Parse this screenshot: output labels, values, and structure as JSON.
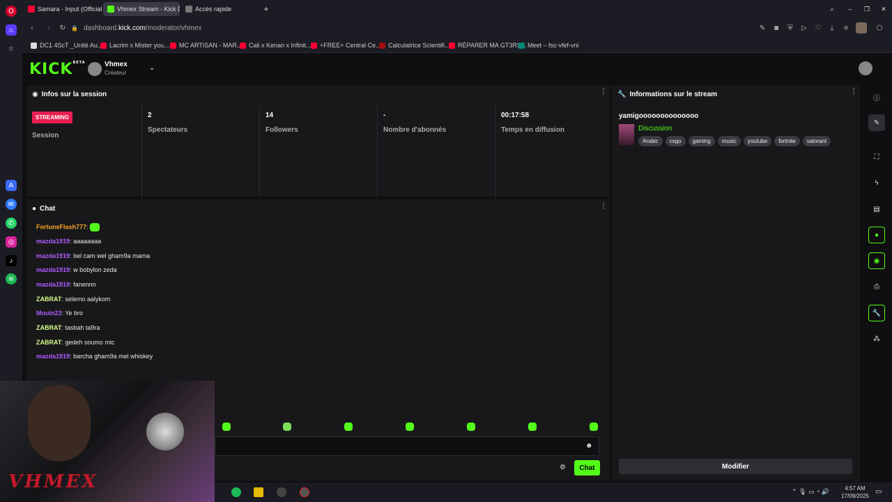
{
  "browser": {
    "tabs": [
      {
        "label": "Samara - Input (Official M"
      },
      {
        "label": "Vhmex Stream - Kick Das"
      },
      {
        "label": "Accès rapide"
      }
    ],
    "url_prefix": "dashboard.",
    "url_host": "kick.com",
    "url_path": "/moderator/vhmex",
    "bookmarks": [
      {
        "label": "DC1 4ScT _Unité Au..."
      },
      {
        "label": "Lacrim x Mister you..."
      },
      {
        "label": "MC ARTISAN - MAR..."
      },
      {
        "label": "Cali x Kenan x Infinit..."
      },
      {
        "label": "+FREE+ Central Ce..."
      },
      {
        "label": "Calculatrice Scientifi..."
      },
      {
        "label": "RÉPARER MA GT3RS..."
      },
      {
        "label": "Meet – fsc-vfef-vni"
      }
    ]
  },
  "kick": {
    "logo": "KICK",
    "logo_sup": "BETA",
    "channel_name": "Vhmex",
    "channel_role": "Créateur"
  },
  "session": {
    "title": "Infos sur la session",
    "badge": "STREAMING",
    "badge_label": "Session",
    "stats": [
      {
        "value": "2",
        "label": "Spectateurs"
      },
      {
        "value": "14",
        "label": "Followers"
      },
      {
        "value": "-",
        "label": "Nombre d'abonnés"
      },
      {
        "value": "00:17:58",
        "label": "Temps en diffusion"
      }
    ]
  },
  "stream_info": {
    "title": "Informations sur le stream",
    "stream_title": "yamigoooooooooooooo",
    "category": "Discussion",
    "tags": [
      "Arabic",
      "csgo",
      "gaming",
      "music",
      "youtube",
      "fortnite",
      "valorant"
    ],
    "modify_button": "Modifier"
  },
  "chat": {
    "title": "Chat",
    "send_button": "Chat",
    "messages": [
      {
        "user": "FortuneFlash777",
        "text": "",
        "color": "#f5a623"
      },
      {
        "user": "mazda1919",
        "text": "aaaaaaaa",
        "color": "#b05cff"
      },
      {
        "user": "mazda1919",
        "text": "bel cam wel gham9a mama",
        "color": "#b05cff"
      },
      {
        "user": "mazda1919",
        "text": "w bobylon zeda",
        "color": "#b05cff"
      },
      {
        "user": "mazda1919",
        "text": "fanennn",
        "color": "#b05cff"
      },
      {
        "user": "ZABRAT",
        "text": "selemo aalykom",
        "color": "#d7ff8a"
      },
      {
        "user": "Mouin23",
        "text": "Ye bro",
        "color": "#b05cff"
      },
      {
        "user": "ZABRAT",
        "text": "tasbah ta9ra",
        "color": "#d7ff8a"
      },
      {
        "user": "ZABRAT",
        "text": "gedeh soumo mic",
        "color": "#d7ff8a"
      },
      {
        "user": "mazda1919",
        "text": "barcha gham9a mel whiskey",
        "color": "#b05cff"
      }
    ]
  },
  "webcam": {
    "overlay_text": "VHMEX"
  },
  "taskbar": {
    "time": "4:57 AM",
    "date": "17/09/2025"
  },
  "colors": {
    "accent": "#53fc18",
    "streaming": "#e91e4f"
  }
}
